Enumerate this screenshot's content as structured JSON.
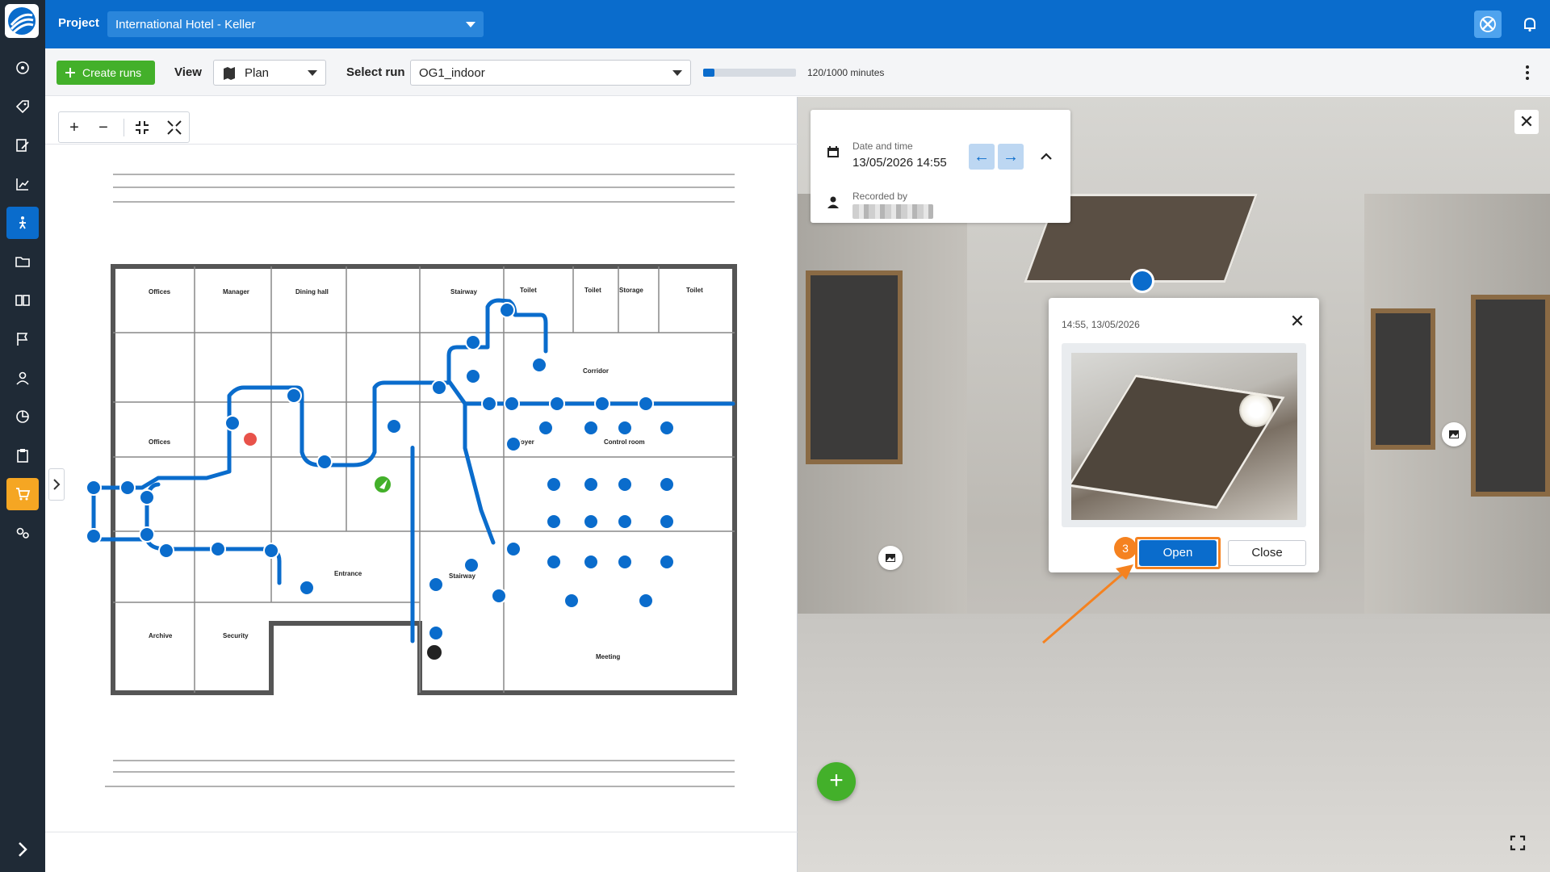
{
  "header": {
    "project_label": "Project",
    "project_value": "International Hotel - Keller"
  },
  "toolbar": {
    "create_runs_label": "Create runs",
    "view_label": "View",
    "view_value": "Plan",
    "select_run_label": "Select run",
    "run_value": "OG1_indoor",
    "progress_fraction": 0.12,
    "progress_text": "120/1000 minutes"
  },
  "sidebar": {
    "items": [
      {
        "icon": "dashboard-icon"
      },
      {
        "icon": "tag-icon"
      },
      {
        "icon": "edit-document-icon"
      },
      {
        "icon": "chart-icon"
      },
      {
        "icon": "walk-icon",
        "active": true
      },
      {
        "icon": "folder-icon"
      },
      {
        "icon": "book-icon"
      },
      {
        "icon": "flag-icon"
      },
      {
        "icon": "person-icon"
      },
      {
        "icon": "pie-chart-icon"
      },
      {
        "icon": "clipboard-icon"
      },
      {
        "icon": "cart-icon",
        "highlight": true
      },
      {
        "icon": "settings-icon"
      }
    ]
  },
  "plan": {
    "rooms": [
      "Offices",
      "Manager",
      "Dining hall",
      "Stairway",
      "Toilet",
      "Toilet",
      "Storage",
      "Toilet",
      "Corridor",
      "Offices",
      "Foyer",
      "Control room",
      "Entrance",
      "Stairway",
      "Archive",
      "Security",
      "Meeting"
    ]
  },
  "panorama": {
    "date_label": "Date and time",
    "date_value": "13/05/2026 14:55",
    "recorded_label": "Recorded by",
    "popup_time": "14:55, 13/05/2026",
    "open_label": "Open",
    "close_label": "Close",
    "step_number": "3"
  },
  "colors": {
    "brand": "#0a6ccc",
    "success": "#43b02a",
    "highlight": "#f58220",
    "sidebar": "#1f2a36"
  }
}
